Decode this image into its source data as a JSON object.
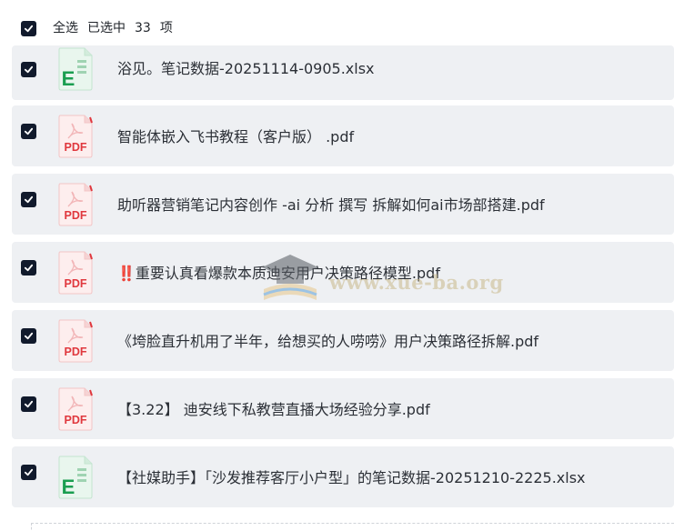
{
  "header": {
    "select_all": "全选",
    "selected_label": "已选中",
    "selected_count": "33",
    "unit": "项"
  },
  "files": [
    {
      "type": "xlsx",
      "icon": "excel-file-icon",
      "prefix": "",
      "name": "浴见。笔记数据-20251114-0905.xlsx",
      "checked": true
    },
    {
      "type": "pdf",
      "icon": "pdf-file-icon",
      "prefix": "",
      "name": "智能体嵌入飞书教程（客户版） .pdf",
      "checked": true
    },
    {
      "type": "pdf",
      "icon": "pdf-file-icon",
      "prefix": "",
      "name": "助听器营销笔记内容创作 -ai 分析 撰写 拆解如何ai市场部搭建.pdf",
      "checked": true
    },
    {
      "type": "pdf",
      "icon": "pdf-file-icon",
      "prefix": "‼️",
      "name": "重要认真看爆款本质迪安用户决策路径模型.pdf",
      "checked": true
    },
    {
      "type": "pdf",
      "icon": "pdf-file-icon",
      "prefix": "",
      "name": "《垮脸直升机用了半年，给想买的人唠唠》用户决策路径拆解.pdf",
      "checked": true
    },
    {
      "type": "pdf",
      "icon": "pdf-file-icon",
      "prefix": "",
      "name": "【3.22】 迪安线下私教营直播大场经验分享.pdf",
      "checked": true
    },
    {
      "type": "xlsx",
      "icon": "excel-file-icon",
      "prefix": "",
      "name": "【社媒助手】「沙发推荐客厅小户型」的笔记数据-20251210-2225.xlsx",
      "checked": true
    }
  ],
  "watermark": {
    "text": "www.xue-ba.org"
  },
  "colors": {
    "checkbox": "#111a2c",
    "row_bg": "#eef0f3",
    "pdf_red": "#e0383e",
    "excel_green": "#1a9e50"
  }
}
